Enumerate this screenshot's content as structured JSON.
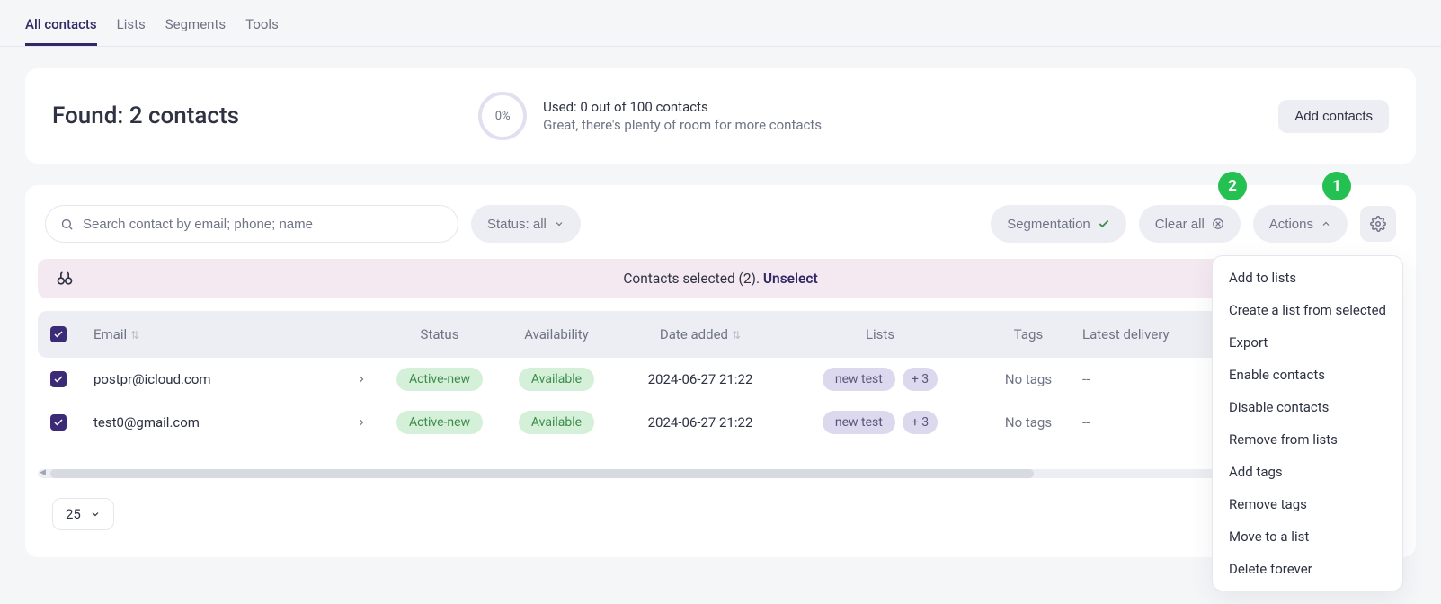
{
  "nav": {
    "tabs": [
      {
        "label": "All contacts",
        "active": true
      },
      {
        "label": "Lists",
        "active": false
      },
      {
        "label": "Segments",
        "active": false
      },
      {
        "label": "Tools",
        "active": false
      }
    ]
  },
  "header": {
    "found_label": "Found: 2 contacts",
    "usage_pct": "0%",
    "usage_line1": "Used: 0 out of 100 contacts",
    "usage_line2": "Great, there's plenty of room for more contacts",
    "add_contacts_label": "Add contacts"
  },
  "toolbar": {
    "search_placeholder": "Search contact by email; phone; name",
    "status_filter_label": "Status: all",
    "segmentation_label": "Segmentation",
    "clear_all_label": "Clear all",
    "actions_label": "Actions"
  },
  "callouts": {
    "b1": "1",
    "b2": "2"
  },
  "selection_bar": {
    "text": "Contacts selected (2). ",
    "unselect_label": "Unselect"
  },
  "columns": {
    "email": "Email",
    "status": "Status",
    "availability": "Availability",
    "date_added": "Date added",
    "lists": "Lists",
    "tags": "Tags",
    "latest_delivery": "Latest delivery"
  },
  "rows": [
    {
      "email": "postpr@icloud.com",
      "status": "Active-new",
      "availability": "Available",
      "date_added": "2024-06-27 21:22",
      "list": "new test",
      "list_more": "+ 3",
      "tags": "No tags",
      "latest_delivery": "--"
    },
    {
      "email": "test0@gmail.com",
      "status": "Active-new",
      "availability": "Available",
      "date_added": "2024-06-27 21:22",
      "list": "new test",
      "list_more": "+ 3",
      "tags": "No tags",
      "latest_delivery": "--"
    }
  ],
  "actions_menu": [
    "Add to lists",
    "Create a list from selected",
    "Export",
    "Enable contacts",
    "Disable contacts",
    "Remove from lists",
    "Add tags",
    "Remove tags",
    "Move to a list",
    "Delete forever"
  ],
  "pagination": {
    "page_size": "25"
  }
}
